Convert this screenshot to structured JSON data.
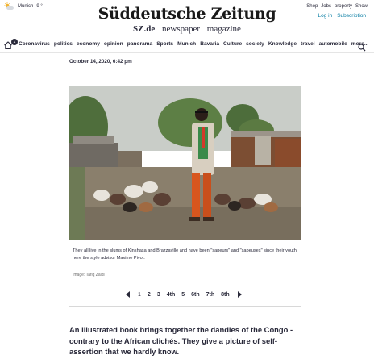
{
  "header": {
    "weather": {
      "city": "Munich",
      "temp": "9 °",
      "icon": "partly-sunny-icon"
    },
    "logo": "Süddeutsche Zeitung",
    "subnav": {
      "site": "SZ.de",
      "newspaper": "newspaper",
      "magazine": "magazine"
    },
    "toplinks": [
      "Shop",
      "Jobs",
      "property",
      "Show"
    ],
    "login": "Log in",
    "subscription": "Subscription"
  },
  "nav": {
    "badge": "2",
    "items": [
      "Coronavirus",
      "politics",
      "economy",
      "opinion",
      "panorama",
      "Sports",
      "Munich",
      "Bavaria",
      "Culture",
      "society",
      "Knowledge",
      "travel",
      "automobile",
      "more..."
    ]
  },
  "article": {
    "date": "October 14, 2020, 6:42 pm",
    "caption": "They all live in the slums of Kinshasa and Brazzaville and have been \"sapeurs\" and \"sapeuses\" since their youth: here the style advisor Maxime Pivot.",
    "credit": "Image: Tariq Zaidi",
    "pages": [
      "1",
      "2",
      "3",
      "4th",
      "5",
      "6th",
      "7th",
      "8th"
    ],
    "current_page": "1",
    "lead": "An illustrated book brings together the dandies of the Congo - contrary to the African clichés. They give a picture of self-assertion that we hardly know."
  },
  "colors": {
    "accent": "#0a7ea4",
    "text": "#29293a"
  }
}
